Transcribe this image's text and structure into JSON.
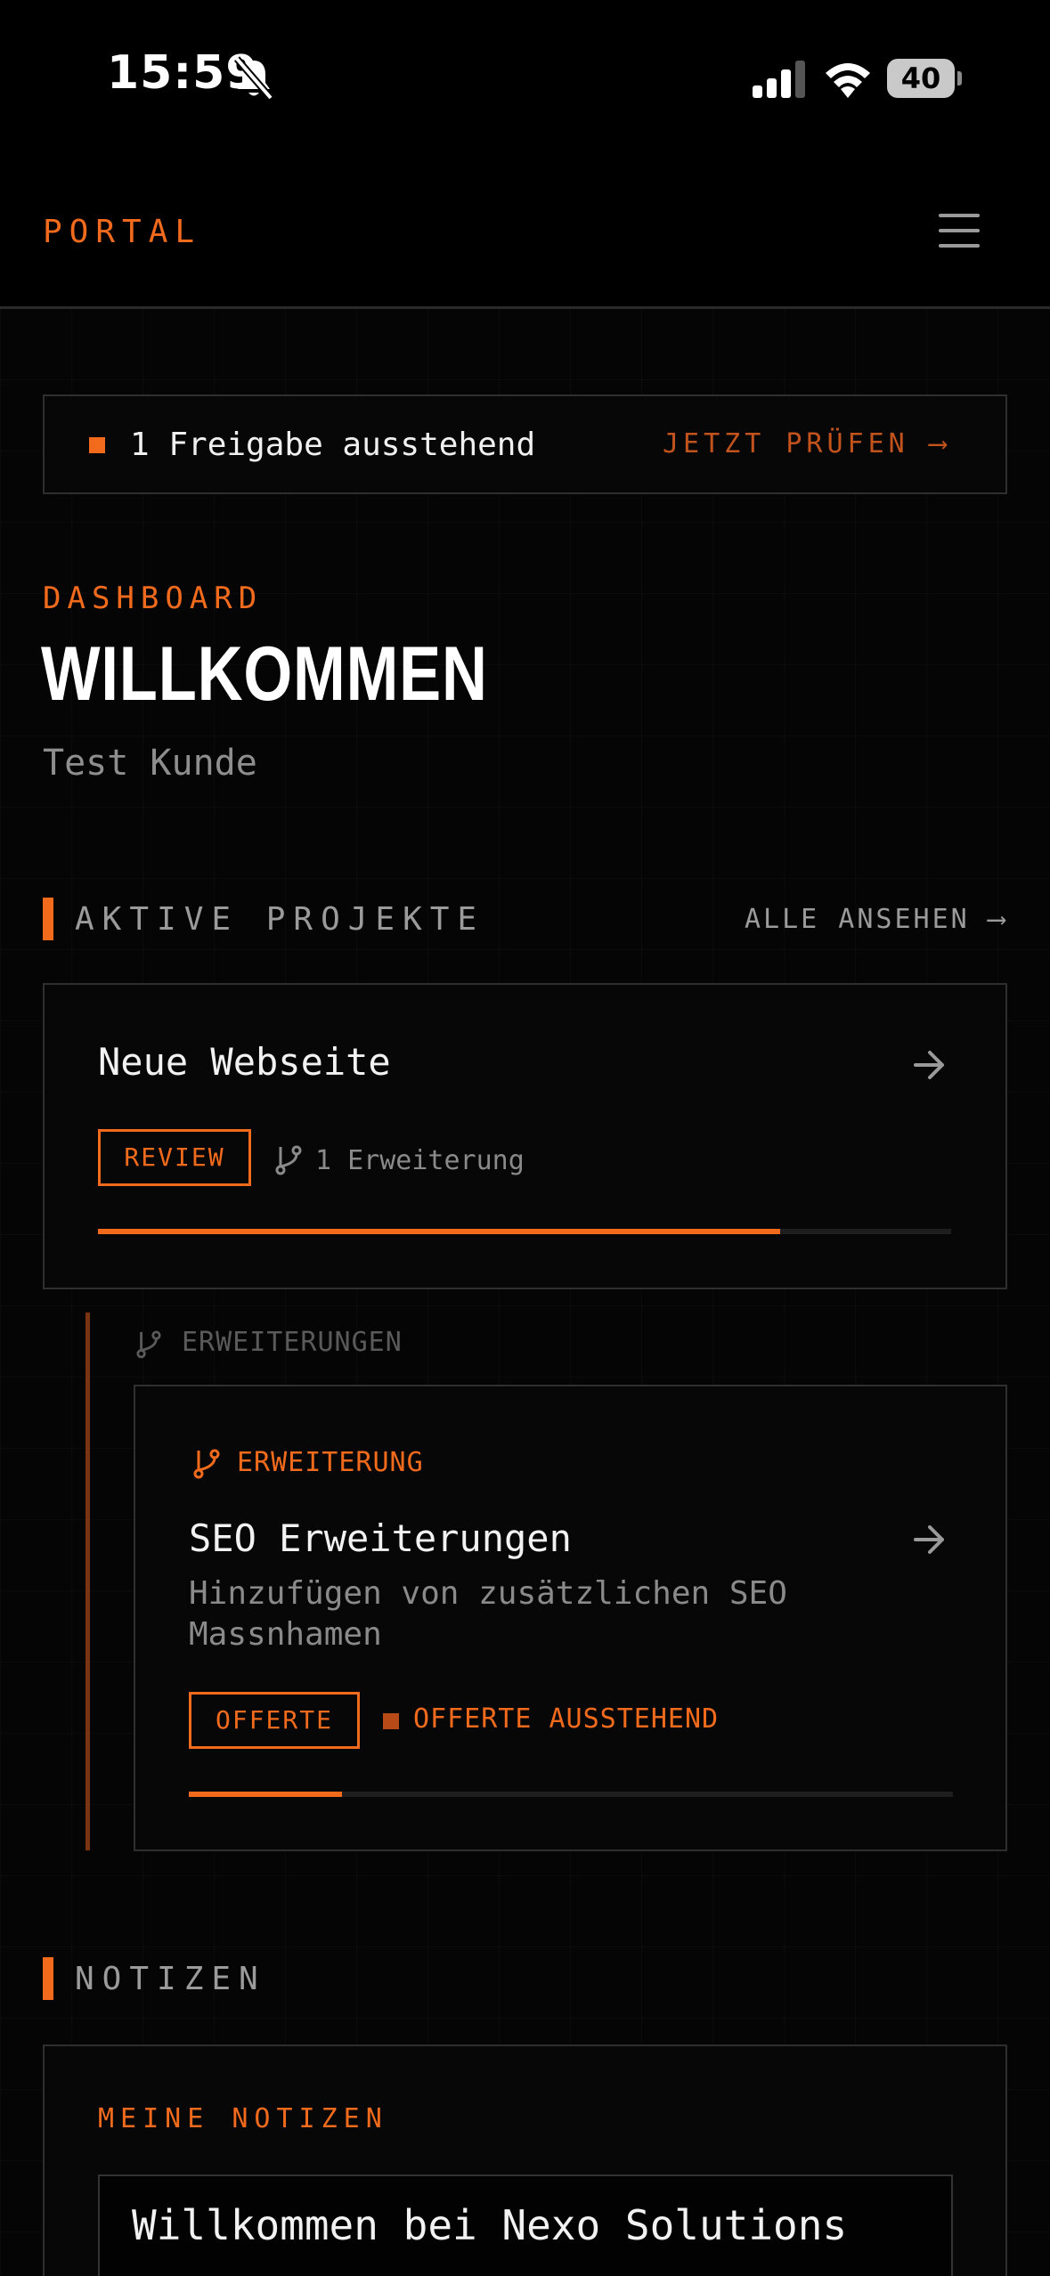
{
  "status_bar": {
    "time": "15:59",
    "battery": "40"
  },
  "header": {
    "brand": "PORTAL"
  },
  "alert": {
    "text": "1 Freigabe ausstehend",
    "action": "JETZT PRÜFEN ⟶"
  },
  "dashboard": {
    "eyebrow": "DASHBOARD",
    "title": "WILLKOMMEN",
    "subtitle": "Test Kunde"
  },
  "projects_section": {
    "title": "AKTIVE PROJEKTE",
    "link": "ALLE ANSEHEN ⟶"
  },
  "project": {
    "title": "Neue Webseite",
    "status": "REVIEW",
    "extensions_count": "1 Erweiterung",
    "progress": 0.8
  },
  "extensions": {
    "label": "ERWEITERUNGEN",
    "items": [
      {
        "type_label": "ERWEITERUNG",
        "title": "SEO Erweiterungen",
        "description_line1": "Hinzufügen von zusätzlichen SEO",
        "description_line2": "Massnhamen",
        "status": "OFFERTE",
        "status_note": "OFFERTE AUSSTEHEND",
        "progress": 0.2
      }
    ]
  },
  "notes_section": {
    "title": "NOTIZEN",
    "card_label": "MEINE NOTIZEN",
    "note_text": "Willkommen bei Nexo Solutions"
  },
  "colors": {
    "accent": "#f26b1d",
    "background": "#050505",
    "border": "#2f2f2f",
    "muted": "#8e8e8e"
  }
}
